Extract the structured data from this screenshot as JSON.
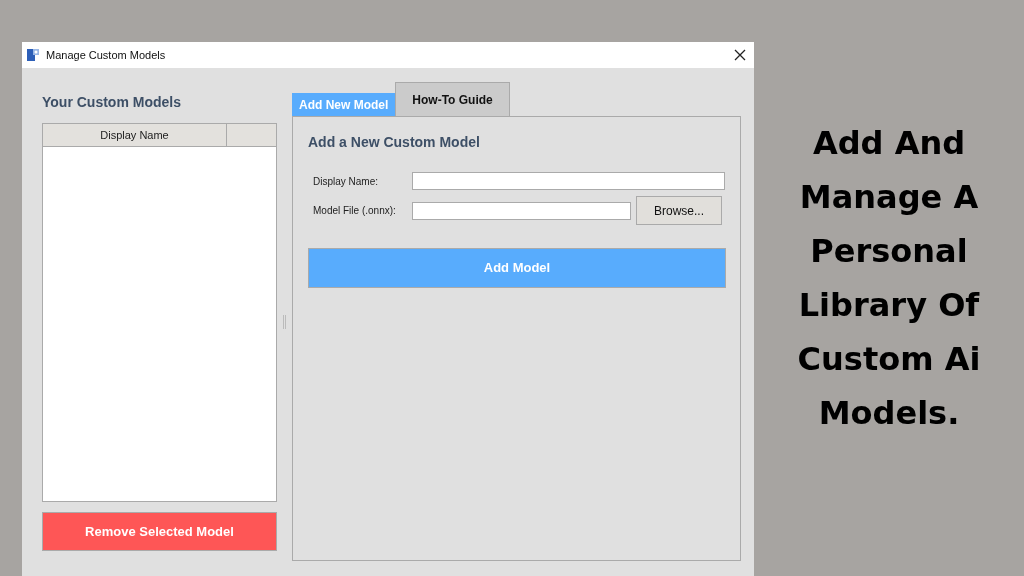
{
  "window": {
    "title": "Manage Custom Models"
  },
  "models_panel": {
    "title": "Your Custom Models",
    "columns": [
      "Display Name"
    ],
    "remove_button": "Remove Selected Model"
  },
  "tabs": [
    {
      "label": "Add New Model",
      "selected": true
    },
    {
      "label": "How-To Guide",
      "selected": false
    }
  ],
  "form": {
    "title": "Add a New Custom Model",
    "fields": [
      {
        "kind": "text",
        "label": "Display Name:"
      },
      {
        "kind": "file",
        "label": "Model File (.onnx):",
        "button": "Browse..."
      }
    ],
    "submit_button": "Add Model"
  },
  "caption": "Add And\nManage A\nPersonal\nLibrary Of\nCustom Ai\nModels."
}
